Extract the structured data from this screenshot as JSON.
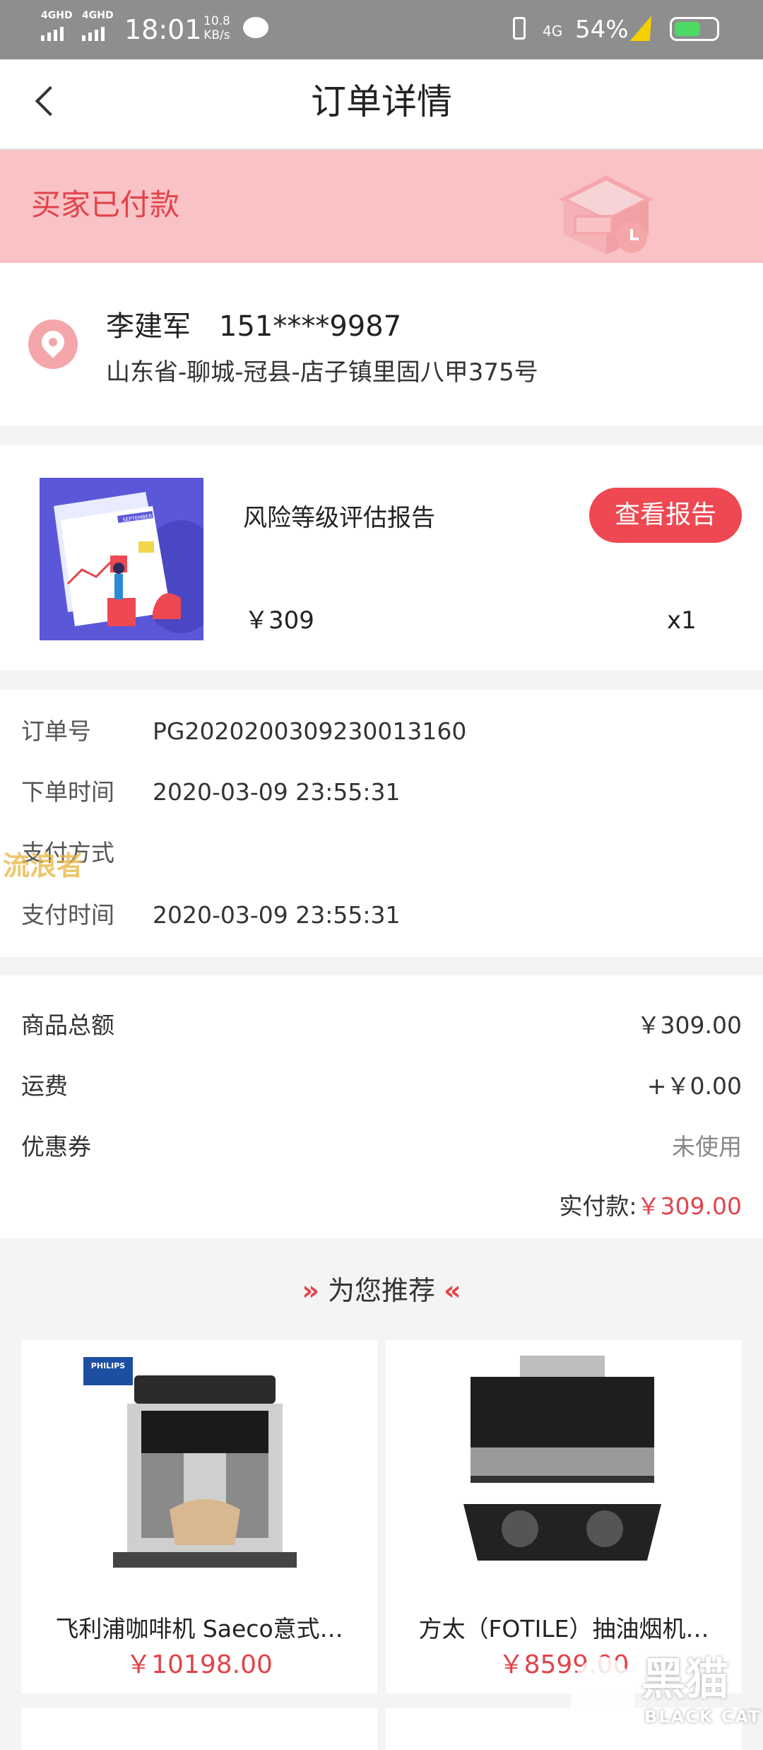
{
  "status_bar": {
    "signal1": "4GHD",
    "signal2": "4GHD",
    "time": "18:01",
    "speed_value": "10.8",
    "speed_unit": "KB/s",
    "network": "4G",
    "battery": "54%"
  },
  "header": {
    "title": "订单详情"
  },
  "banner": {
    "status": "买家已付款"
  },
  "address": {
    "name": "李建军",
    "phone": "151****9987",
    "line": "山东省-聊城-冠县-店子镇里固八甲375号"
  },
  "product": {
    "name": "风险等级评估报告",
    "report_button": "查看报告",
    "price": "￥309",
    "qty": "x1",
    "thumb_caption": "SEPTEMBER"
  },
  "order_info": {
    "order_no_label": "订单号",
    "order_no": "PG2020200309230013160",
    "order_time_label": "下单时间",
    "order_time": "2020-03-09 23:55:31",
    "pay_method_label": "支付方式",
    "pay_method": "",
    "pay_time_label": "支付时间",
    "pay_time": "2020-03-09 23:55:31",
    "watermark": "流浪者"
  },
  "amounts": {
    "goods_total_label": "商品总额",
    "goods_total": "￥309.00",
    "shipping_label": "运费",
    "shipping": "+￥0.00",
    "coupon_label": "优惠券",
    "coupon": "未使用",
    "paid_label": "实付款:",
    "paid": "￥309.00"
  },
  "recommend": {
    "title": "为您推荐",
    "items": [
      {
        "name": "飞利浦咖啡机 Saeco意式…",
        "price": "￥10198.00",
        "brand": "PHILIPS"
      },
      {
        "name": "方太（FOTILE）抽油烟机…",
        "price": "￥8599.00"
      }
    ]
  },
  "corner_logo": {
    "cn": "黑猫",
    "en": "BLACK CAT"
  },
  "colors": {
    "accent": "#e2434b",
    "banner_bg": "#f9c2c5",
    "button": "#ee4852"
  }
}
